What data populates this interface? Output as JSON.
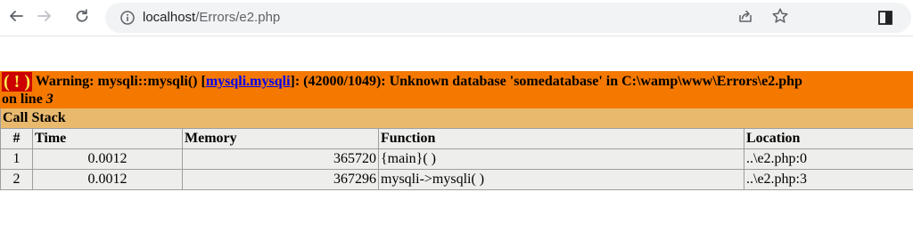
{
  "browser": {
    "url_host": "localhost",
    "url_path": "/Errors/e2.php"
  },
  "error": {
    "badge": "( ! )",
    "prefix": "Warning: mysqli::mysqli() [",
    "link_text": "mysqli.mysqli",
    "suffix": "]: (42000/1049): Unknown database 'somedatabase' in C:\\wamp\\www\\Errors\\e2.php",
    "line_label": "on line ",
    "line_number": "3"
  },
  "callstack": {
    "title": "Call Stack",
    "headers": {
      "num": "#",
      "time": "Time",
      "memory": "Memory",
      "function": "Function",
      "location": "Location"
    },
    "rows": [
      {
        "num": "1",
        "time": "0.0012",
        "memory": "365720",
        "function": "{main}( )",
        "location": "..\\e2.php:0"
      },
      {
        "num": "2",
        "time": "0.0012",
        "memory": "367296",
        "function": "mysqli->mysqli( )",
        "location": "..\\e2.php:3"
      }
    ]
  },
  "icons": [
    "back-arrow-icon",
    "forward-arrow-icon",
    "reload-icon",
    "info-icon",
    "share-icon",
    "star-icon",
    "side-panel-icon"
  ],
  "colors": {
    "warning_bg": "#f57900",
    "badge_bg": "#cc0000",
    "badge_text": "#fce94f",
    "callstack_bg": "#e9b96e",
    "cell_bg": "#eeeeec"
  }
}
